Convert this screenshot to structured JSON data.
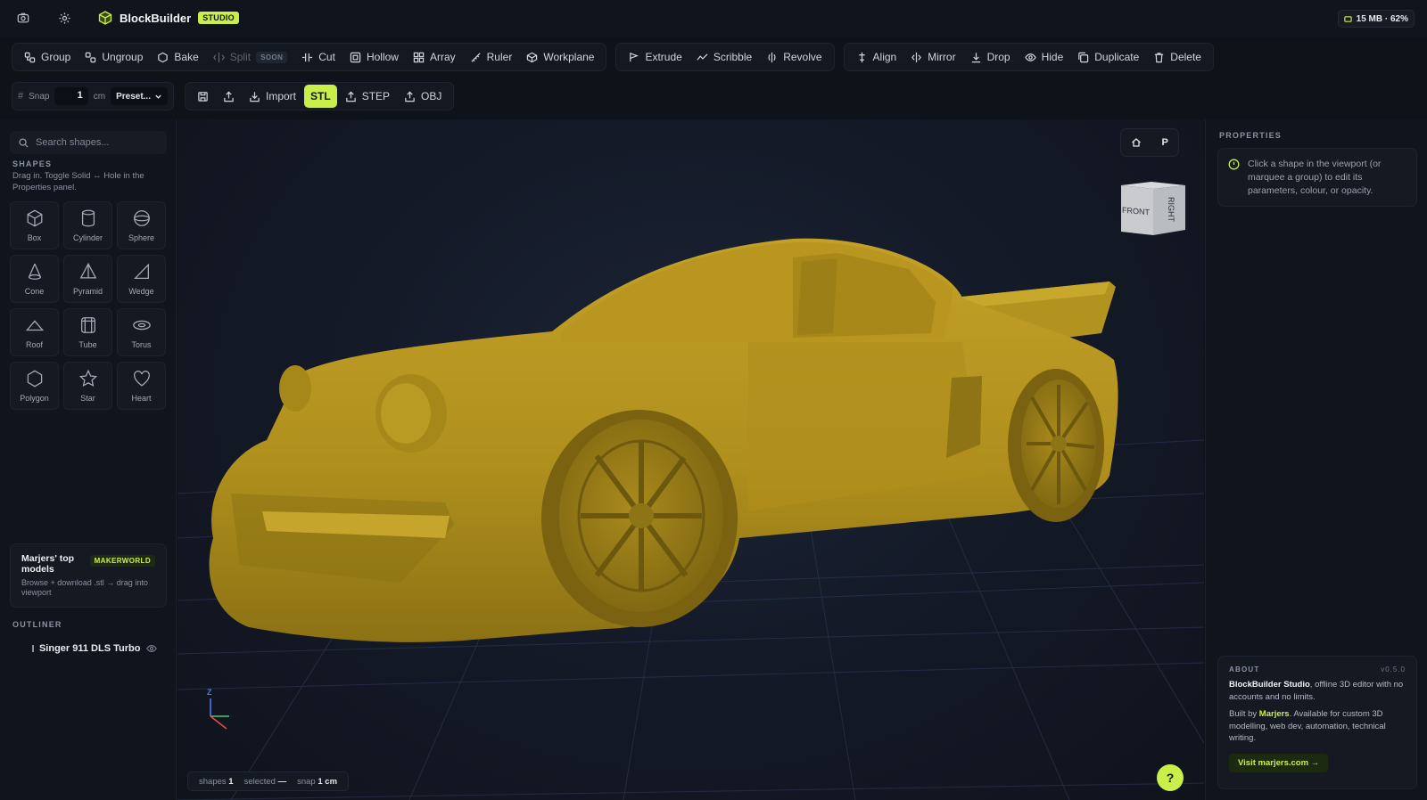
{
  "app": {
    "brand": "BlockBuilder",
    "badge": "STUDIO",
    "memory": "15 MB · 62%"
  },
  "toolbar": {
    "groups": [
      [
        {
          "label": "Group",
          "icon": "group-icon"
        },
        {
          "label": "Ungroup",
          "icon": "ungroup-icon"
        },
        {
          "label": "Bake",
          "icon": "bake-icon"
        },
        {
          "label": "Split",
          "icon": "split-icon",
          "badge": "SOON",
          "disabled": true
        },
        {
          "label": "Cut",
          "icon": "cut-icon"
        },
        {
          "label": "Hollow",
          "icon": "hollow-icon"
        },
        {
          "label": "Array",
          "icon": "array-icon"
        },
        {
          "label": "Ruler",
          "icon": "ruler-icon"
        },
        {
          "label": "Workplane",
          "icon": "workplane-icon"
        }
      ],
      [
        {
          "label": "Extrude",
          "icon": "extrude-icon"
        },
        {
          "label": "Scribble",
          "icon": "scribble-icon"
        },
        {
          "label": "Revolve",
          "icon": "revolve-icon"
        }
      ],
      [
        {
          "label": "Align",
          "icon": "align-icon"
        },
        {
          "label": "Mirror",
          "icon": "mirror-icon"
        },
        {
          "label": "Drop",
          "icon": "drop-icon"
        },
        {
          "label": "Hide",
          "icon": "eye-icon"
        },
        {
          "label": "Duplicate",
          "icon": "duplicate-icon"
        },
        {
          "label": "Delete",
          "icon": "trash-icon"
        }
      ]
    ]
  },
  "snapbar": {
    "snap_label": "Snap",
    "snap_value": "1",
    "unit": "cm",
    "preset": "Preset...",
    "import_label": "Import",
    "formats": [
      "STL",
      "STEP",
      "OBJ"
    ],
    "active_format": "STL"
  },
  "left": {
    "search_placeholder": "Search shapes...",
    "shapes_heading": "SHAPES",
    "shapes_hint": "Drag in. Toggle Solid ↔ Hole in the Properties panel.",
    "shapes": [
      {
        "label": "Box",
        "icon": "box-icon"
      },
      {
        "label": "Cylinder",
        "icon": "cylinder-icon"
      },
      {
        "label": "Sphere",
        "icon": "sphere-icon"
      },
      {
        "label": "Cone",
        "icon": "cone-icon"
      },
      {
        "label": "Pyramid",
        "icon": "pyramid-icon"
      },
      {
        "label": "Wedge",
        "icon": "wedge-icon"
      },
      {
        "label": "Roof",
        "icon": "roof-icon"
      },
      {
        "label": "Tube",
        "icon": "tube-icon"
      },
      {
        "label": "Torus",
        "icon": "torus-icon"
      },
      {
        "label": "Polygon",
        "icon": "polygon-icon"
      },
      {
        "label": "Star",
        "icon": "star-icon"
      },
      {
        "label": "Heart",
        "icon": "heart-icon"
      }
    ],
    "promo": {
      "title": "Marjers' top models",
      "badge": "MAKERWORLD",
      "desc": "Browse + download .stl → drag into viewport"
    },
    "outliner_heading": "OUTLINER",
    "outliner_items": [
      {
        "label": "Singer 911 DLS Turbo",
        "visible": true
      }
    ]
  },
  "viewport": {
    "view_buttons": {
      "home": "home-icon",
      "projection": "P"
    },
    "view_cube": {
      "front": "FRONT",
      "right": "RIGHT"
    },
    "axis_label": "Z",
    "model_color": "#b99a1f",
    "status": {
      "shapes_label": "shapes",
      "shapes_value": "1",
      "selected_label": "selected",
      "selected_value": "—",
      "snap_label": "snap",
      "snap_value": "1 cm"
    },
    "help": "?"
  },
  "right": {
    "properties_heading": "PROPERTIES",
    "properties_hint": "Click a shape in the viewport (or marquee a group) to edit its parameters, colour, or opacity.",
    "about": {
      "heading": "ABOUT",
      "version": "v0.5.0",
      "line1_brand": "BlockBuilder Studio",
      "line1_rest": ", offline 3D editor with no accounts and no limits.",
      "line2_pre": "Built by ",
      "line2_author": "Marjers",
      "line2_rest": ". Available for custom 3D modelling, web dev, automation, technical writing.",
      "cta": "Visit marjers.com →"
    }
  },
  "colors": {
    "accent": "#c9f04a",
    "background": "#0e1219",
    "panel": "#10141c"
  }
}
